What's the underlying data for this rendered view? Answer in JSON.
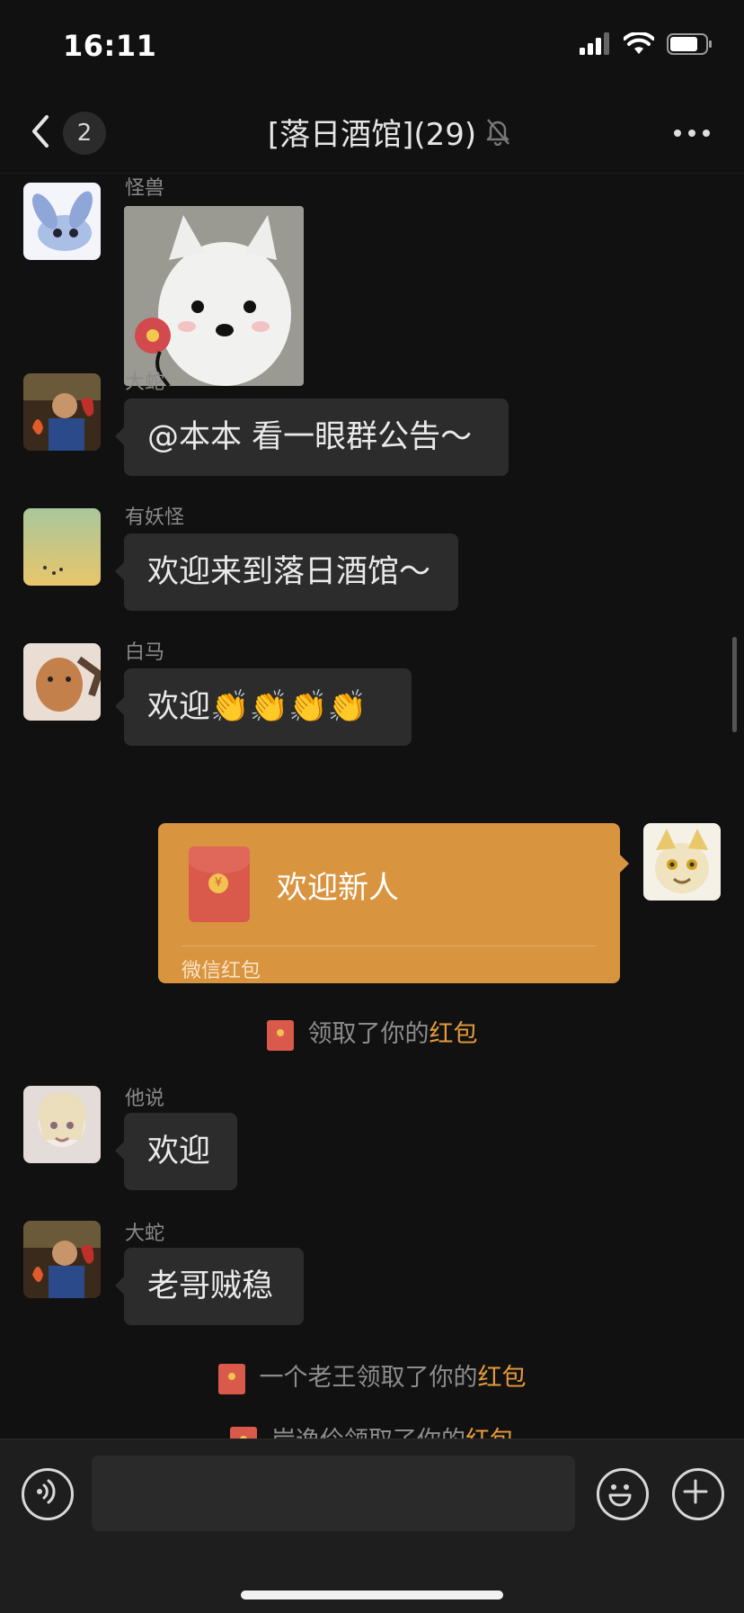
{
  "status_bar": {
    "time": "16:11"
  },
  "nav": {
    "unread_count": "2",
    "title": "[落日酒馆](29)"
  },
  "messages": [
    {
      "sender": "怪兽",
      "type": "sticker"
    },
    {
      "sender": "大蛇",
      "text": "@本本 看一眼群公告～"
    },
    {
      "sender": "有妖怪",
      "text": "欢迎来到落日酒馆～"
    },
    {
      "sender": "白马",
      "text": "欢迎👏👏👏👏"
    },
    {
      "sender": "他说",
      "text": "欢迎"
    },
    {
      "sender": "大蛇",
      "text": "老哥贼稳"
    }
  ],
  "red_packet": {
    "title": "欢迎新人",
    "label": "微信红包",
    "coin": "¥"
  },
  "system_messages": [
    {
      "prefix": "领取了你的",
      "highlight": "红包"
    },
    {
      "prefix": "一个老王领取了你的",
      "highlight": "红包"
    },
    {
      "prefix": "岸逸伶领取了你的",
      "highlight": "红包"
    }
  ],
  "input": {
    "placeholder": ""
  },
  "colors": {
    "background": "#111111",
    "bubble": "#2c2c2c",
    "red_packet": "#d99440",
    "highlight": "#e59a3c"
  }
}
